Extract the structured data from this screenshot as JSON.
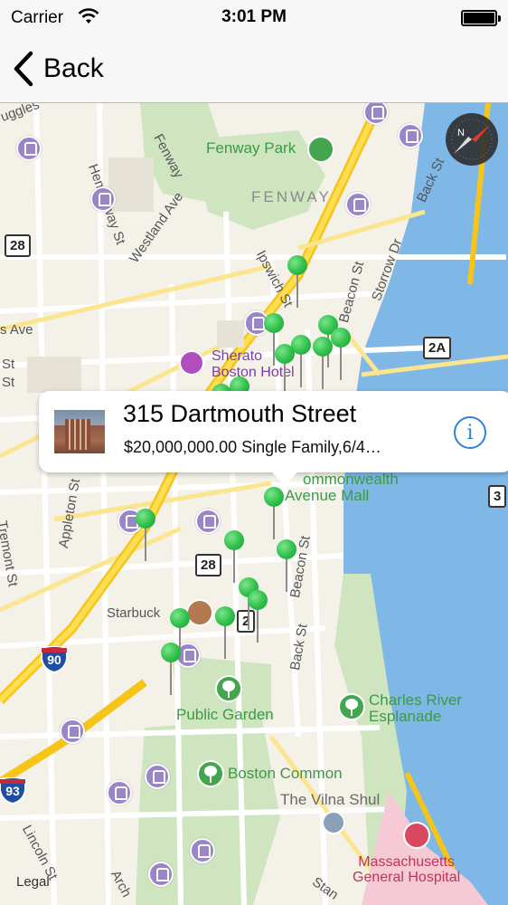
{
  "status_bar": {
    "carrier": "Carrier",
    "time": "3:01 PM"
  },
  "nav": {
    "back_label": "Back"
  },
  "map": {
    "area_labels": {
      "fenway": "FENWAY"
    },
    "parks": {
      "fenway_park": "Fenway Park",
      "public_garden": "Public Garden",
      "boston_common": "Boston Common",
      "charles_river_line1": "Charles River",
      "charles_river_line2": "Esplanade",
      "commonwealth_line1": "ommonwealth",
      "commonwealth_line2": "Avenue Mall"
    },
    "pois": {
      "sheraton_line1": "Sherato",
      "sheraton_line2": "Boston Hotel",
      "starbucks": "Starbuck",
      "vilna_shul": "The Vilna Shul",
      "mgh_line1": "Massachusetts",
      "mgh_line2": "General Hospital"
    },
    "streets": {
      "fenway": "Fenway",
      "hemenway": "Hemenway St",
      "westland": "Westland Ave",
      "ipswich": "Ipswich St",
      "beacon_top": "Beacon St",
      "storrow": "Storrow Dr",
      "back_st": "Back St",
      "s_ave": "s Ave",
      "appleton": "Appleton St",
      "tremont": "Tremont St",
      "beacon_mid": "Beacon St",
      "back_st_mid": "Back St",
      "lincoln": "Lincoln St",
      "stanho": "Stan",
      "arch": "Arch",
      "uggles": "uggles",
      "st_side1": "St",
      "st_side2": "St"
    },
    "route_shields": {
      "r28_left": "28",
      "r28_mid": "28",
      "r2a": "2A",
      "r2_mid": "2",
      "r3_right": "3"
    },
    "interstates": {
      "i90": "90",
      "i93": "93"
    },
    "legal": "Legal"
  },
  "callout": {
    "title": "315 Dartmouth Street",
    "subtitle": "$20,000,000.00 Single Family,6/4…",
    "info_icon": "info-icon"
  },
  "colors": {
    "pin_green": "#2fbf4a",
    "info_blue": "#2f7fe0",
    "transit_purple": "#9b85c9",
    "park_green": "#43a64f",
    "water_blue": "#7fb7e6"
  }
}
